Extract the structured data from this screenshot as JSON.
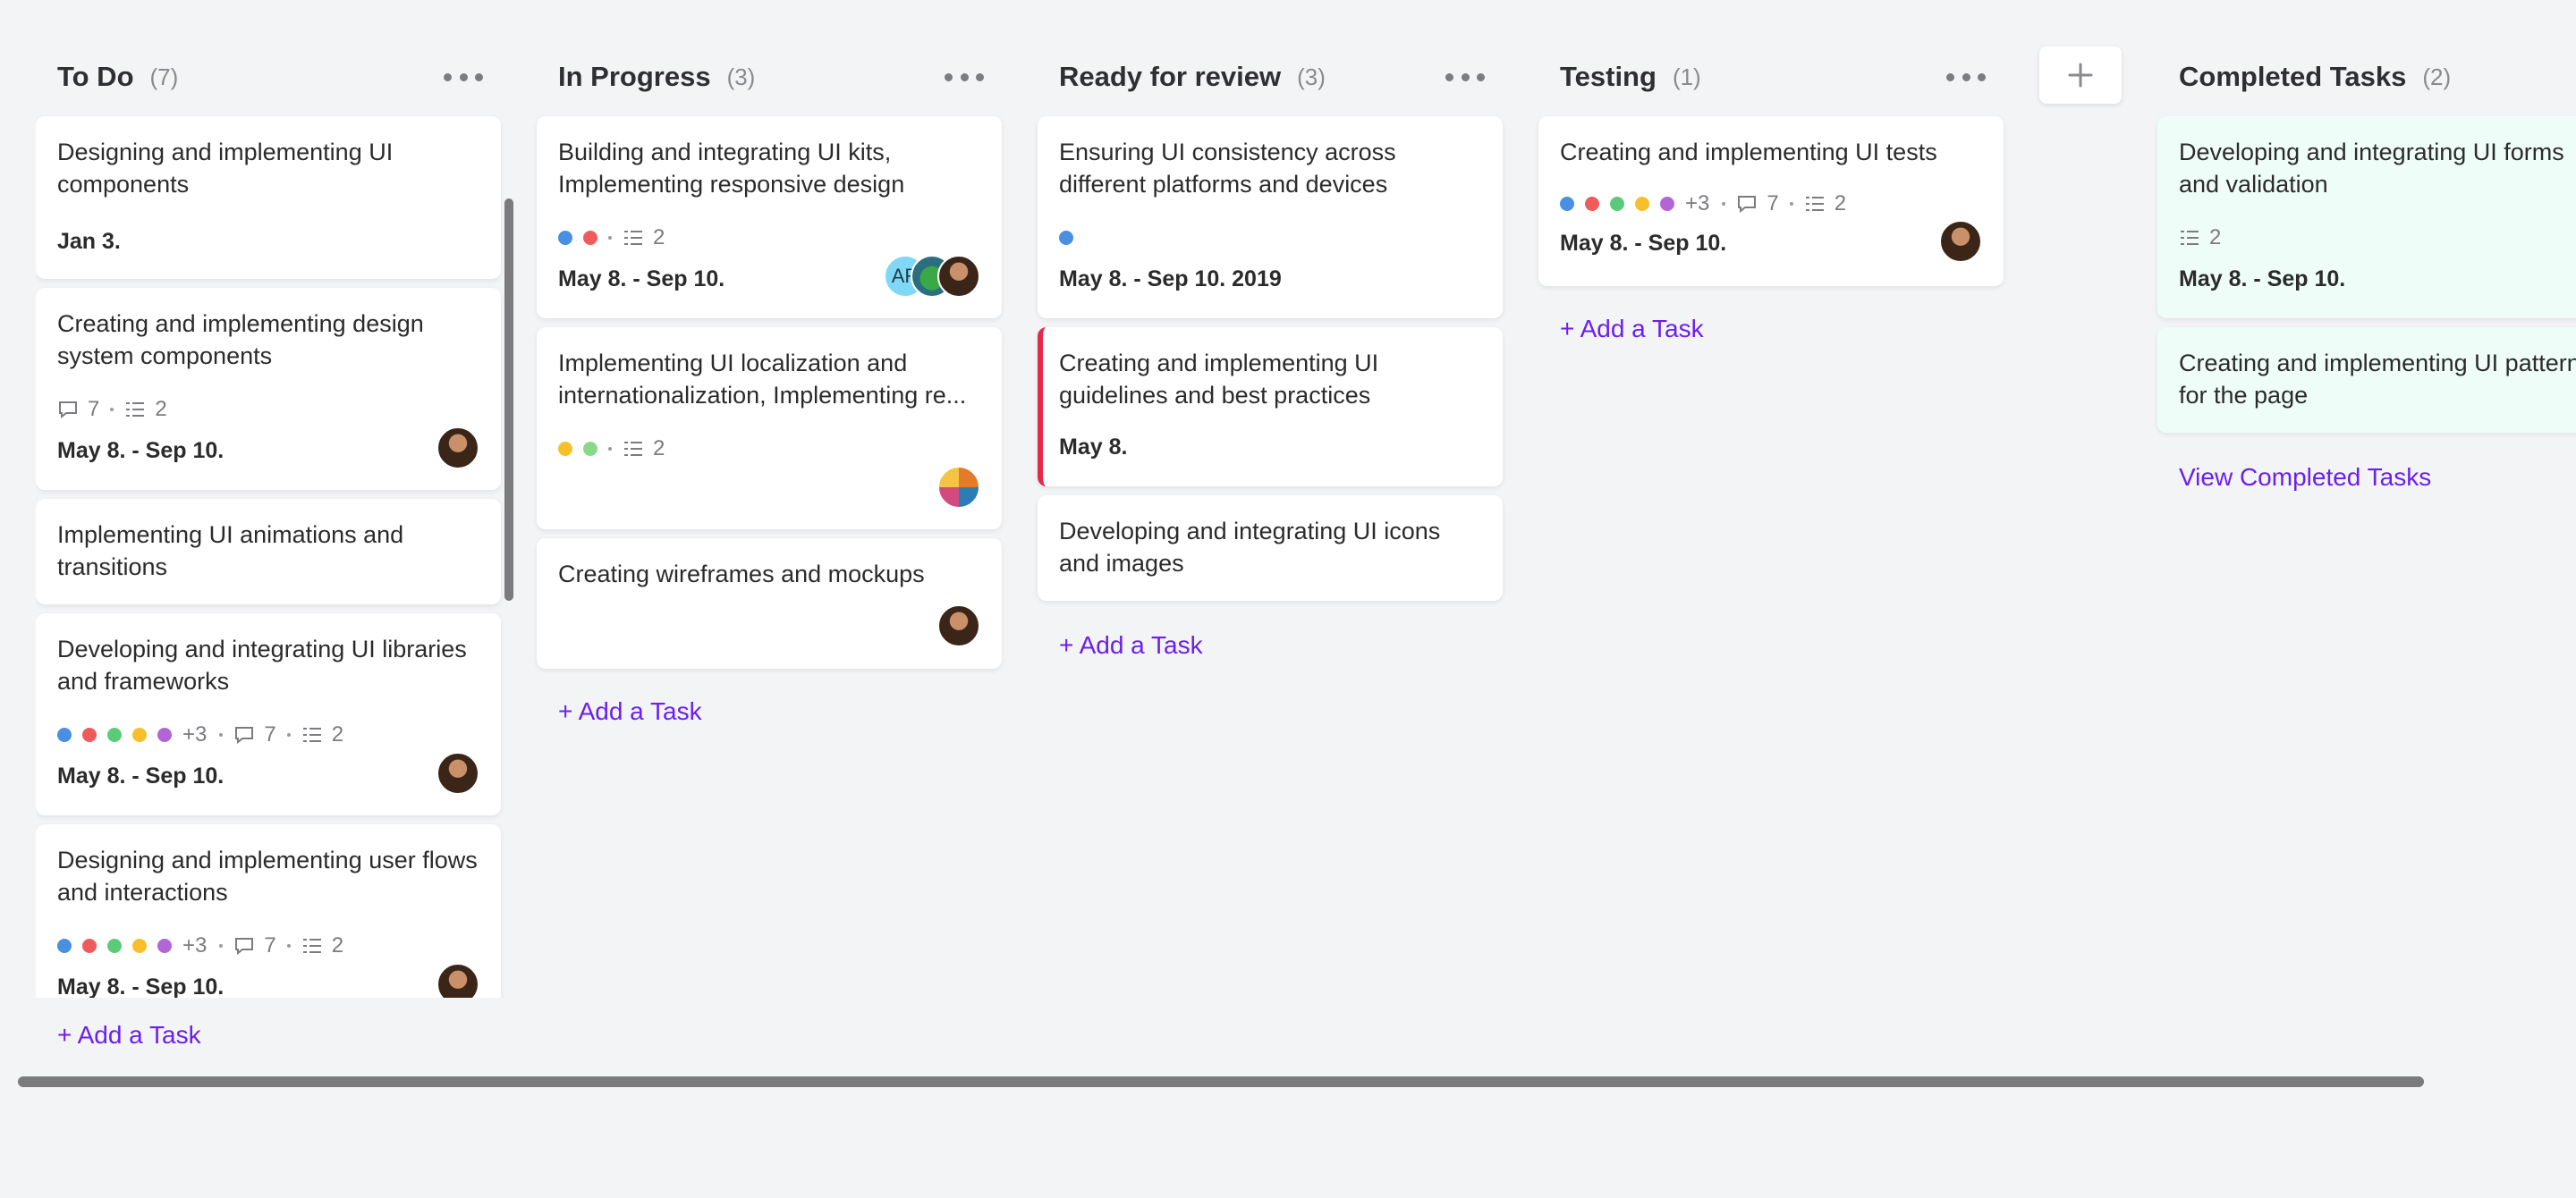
{
  "columns": [
    {
      "title": "To Do",
      "count": "(7)",
      "cards": [
        {
          "title": "Designing and implementing UI components",
          "date": "Jan 3."
        },
        {
          "title": "Creating and implementing design system components",
          "comments": "7",
          "subtasks": "2",
          "date": "May 8. - Sep 10."
        },
        {
          "title": "Implementing UI animations and transitions"
        },
        {
          "title": "Developing and integrating UI libraries and frameworks",
          "more_labels": "+3",
          "comments": "7",
          "subtasks": "2",
          "date": "May 8. - Sep 10."
        },
        {
          "title": "Designing and implementing user flows and interactions",
          "more_labels": "+3",
          "comments": "7",
          "subtasks": "2",
          "date": "May 8. - Sep 10."
        }
      ],
      "add_task": "+ Add a Task"
    },
    {
      "title": "In Progress",
      "count": "(3)",
      "cards": [
        {
          "title": "Building and integrating UI kits, Implementing responsive design",
          "subtasks": "2",
          "date": "May 8. - Sep 10.",
          "avatar_initials": "AR"
        },
        {
          "title": "Implementing UI localization and internationalization, Implementing re...",
          "subtasks": "2"
        },
        {
          "title": "Creating wireframes and mockups"
        }
      ],
      "add_task": "+ Add a Task"
    },
    {
      "title": "Ready for review",
      "count": "(3)",
      "cards": [
        {
          "title": "Ensuring UI consistency across different platforms and devices",
          "date": "May 8. - Sep 10. 2019"
        },
        {
          "title": "Creating and implementing UI guidelines and best practices",
          "date": "May 8."
        },
        {
          "title": "Developing and integrating UI icons and images"
        }
      ],
      "add_task": "+ Add a Task"
    },
    {
      "title": "Testing",
      "count": "(1)",
      "cards": [
        {
          "title": "Creating and implementing UI tests",
          "more_labels": "+3",
          "comments": "7",
          "subtasks": "2",
          "date": "May 8. - Sep 10."
        }
      ],
      "add_task": "+ Add a Task"
    },
    {
      "title": "Completed Tasks",
      "count": "(2)",
      "cards": [
        {
          "title": "Developing and integrating UI forms and validation",
          "subtasks": "2",
          "date": "May 8. - Sep 10."
        },
        {
          "title": "Creating and implementing UI patterns for the page"
        }
      ],
      "view_link": "View Completed Tasks"
    }
  ],
  "icons": {
    "column_menu": "more-horizontal-icon",
    "comments": "comment-icon",
    "subtasks": "checklist-icon",
    "add_column": "plus-icon"
  },
  "colors": {
    "accent": "#6a1ff0",
    "priority_flag": "#e5294e",
    "completed_card_bg": "#effdf8",
    "label_blue": "#4a90e2",
    "label_red": "#ef5b5b",
    "label_green": "#5ccb79",
    "label_yellow": "#f7c02b",
    "label_purple": "#b365d6",
    "label_lightgreen": "#8bd88b"
  }
}
